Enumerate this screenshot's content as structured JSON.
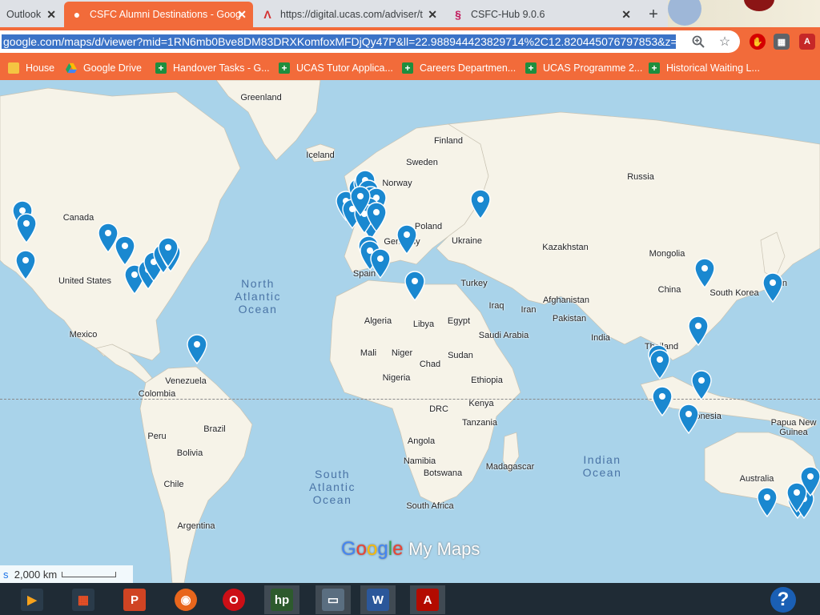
{
  "tabs": [
    {
      "title": "Outlook",
      "active": false
    },
    {
      "title": "CSFC Alumni Destinations - Goog",
      "active": true
    },
    {
      "title": "https://digital.ucas.com/adviser/t",
      "active": false
    },
    {
      "title": "CSFC-Hub 9.0.6",
      "active": false
    }
  ],
  "address": {
    "url": "google.com/maps/d/viewer?mid=1RN6mb0Bve8DM83DRXKomfoxMFDjQy47P&ll=22.988944423829714%2C12.820445076797853&z=2"
  },
  "bookmarks": [
    {
      "label": "House",
      "icon": "folder-icon",
      "color": "#f4c542"
    },
    {
      "label": "Google Drive",
      "icon": "google-drive-icon",
      "color": "#1fa463"
    },
    {
      "label": "Handover Tasks - G...",
      "icon": "google-sheets-icon",
      "color": "#1e8e3e"
    },
    {
      "label": "UCAS Tutor Applica...",
      "icon": "google-sheets-icon",
      "color": "#1e8e3e"
    },
    {
      "label": "Careers Departmen...",
      "icon": "google-sheets-icon",
      "color": "#1e8e3e"
    },
    {
      "label": "UCAS Programme 2...",
      "icon": "google-sheets-icon",
      "color": "#1e8e3e"
    },
    {
      "label": "Historical Waiting L...",
      "icon": "google-sheets-icon",
      "color": "#1e8e3e"
    }
  ],
  "map": {
    "labels": [
      {
        "text": "Greenland"
      },
      {
        "text": "Finland"
      },
      {
        "text": "Iceland"
      },
      {
        "text": "Sweden"
      },
      {
        "text": "Norway"
      },
      {
        "text": "Russia"
      },
      {
        "text": "Canada"
      },
      {
        "text": "Poland"
      },
      {
        "text": "Germany"
      },
      {
        "text": "Ukraine"
      },
      {
        "text": "Kazakhstan"
      },
      {
        "text": "Mongolia"
      },
      {
        "text": "Spain"
      },
      {
        "text": "Turkey"
      },
      {
        "text": "United States"
      },
      {
        "text": "China"
      },
      {
        "text": "South Korea"
      },
      {
        "text": "Japan"
      },
      {
        "text": "Iraq"
      },
      {
        "text": "Iran"
      },
      {
        "text": "Afghanistan"
      },
      {
        "text": "Algeria"
      },
      {
        "text": "Libya"
      },
      {
        "text": "Egypt"
      },
      {
        "text": "Pakistan"
      },
      {
        "text": "Mexico"
      },
      {
        "text": "Saudi Arabia"
      },
      {
        "text": "India"
      },
      {
        "text": "Thailand"
      },
      {
        "text": "Mali"
      },
      {
        "text": "Niger"
      },
      {
        "text": "Chad"
      },
      {
        "text": "Sudan"
      },
      {
        "text": "Venezuela"
      },
      {
        "text": "Nigeria"
      },
      {
        "text": "Ethiopia"
      },
      {
        "text": "Colombia"
      },
      {
        "text": "Kenya"
      },
      {
        "text": "DRC"
      },
      {
        "text": "Indonesia"
      },
      {
        "text": "Papua New Guinea"
      },
      {
        "text": "Brazil"
      },
      {
        "text": "Tanzania"
      },
      {
        "text": "Peru"
      },
      {
        "text": "Angola"
      },
      {
        "text": "Bolivia"
      },
      {
        "text": "Namibia"
      },
      {
        "text": "Madagascar"
      },
      {
        "text": "Botswana"
      },
      {
        "text": "Australia"
      },
      {
        "text": "Chile"
      },
      {
        "text": "South Africa"
      },
      {
        "text": "Argentina"
      }
    ],
    "oceans": [
      {
        "text": "North\nAtlantic\nOcean"
      },
      {
        "text": "South\nAtlantic\nOcean"
      },
      {
        "text": "Indian\nOcean"
      }
    ],
    "pin_color": "#1a88d0",
    "pin_count": 45,
    "brand": "Google My Maps",
    "scale_label": "2,000 km"
  },
  "taskbar": {
    "icons": [
      "media-player-icon",
      "office-apps-icon",
      "powerpoint-icon",
      "firefox-icon",
      "opera-icon",
      "hp-icon",
      "computer-icon",
      "word-icon",
      "acrobat-icon"
    ]
  },
  "help_label": "?"
}
